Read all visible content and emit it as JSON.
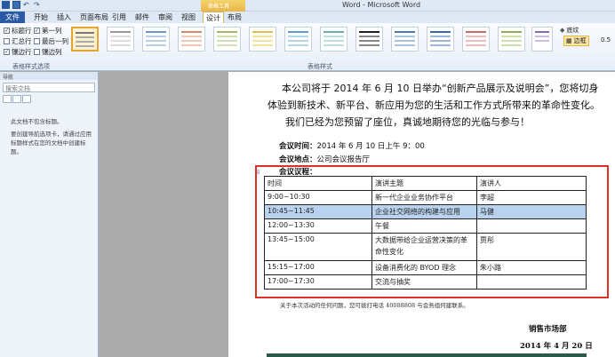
{
  "window": {
    "title": "Word - Microsoft Word",
    "context_tab": "表格工具"
  },
  "tabs": [
    "文件",
    "开始",
    "插入",
    "页面布局",
    "引用",
    "邮件",
    "审阅",
    "视图",
    "设计",
    "布局"
  ],
  "table_options": {
    "group_label": "表格样式选项",
    "items": [
      {
        "label": "标题行",
        "checked": true
      },
      {
        "label": "第一列",
        "checked": true
      },
      {
        "label": "汇总行",
        "checked": false
      },
      {
        "label": "最后一列",
        "checked": false
      },
      {
        "label": "镶边行",
        "checked": true
      },
      {
        "label": "镶边列",
        "checked": false
      }
    ]
  },
  "styles_group_label": "表格样式",
  "right_panel": {
    "shading": "底纹",
    "borders": "边框",
    "pen_weight": "0.5"
  },
  "nav_pane": {
    "title": "导航",
    "search_placeholder": "搜索文档",
    "msg1": "此文档不包含标题。",
    "msg2": "要创建导航选项卡，请通过应用标题样式在您的文档中创建标题。"
  },
  "document": {
    "intro_lines": [
      "本公司将于 2014 年 6 月 10 日举办“创新产品展示及说明会”，您将切身",
      "体验到新技术、新平台、新应用为您的生活和工作方式所带来的革命性变化。",
      "我们已经为您预留了座位，真诚地期待您的光临与参与！"
    ],
    "meeting_time_label": "会议时间：",
    "meeting_time_value": "2014 年 6 月 10 日上午 9：00",
    "meeting_place_label": "会议地点：",
    "meeting_place_value": "公司会议报告厅",
    "agenda_label": "会议议程：",
    "table_header": [
      "时间",
      "演讲主题",
      "演讲人"
    ],
    "table_rows": [
      [
        "9:00~10:30",
        "新一代企业业务协作平台",
        "李超"
      ],
      [
        "10:45~11:45",
        "企业社交网络的构建与应用",
        "马健"
      ],
      [
        "12:00~13:30",
        "午餐",
        ""
      ],
      [
        "13:45~15:00",
        "大数据带给企业运营决策的革命性变化",
        "贾彤"
      ],
      [
        "15:15~17:00",
        "设备消费化的 BYOD 理念",
        "朱小路"
      ],
      [
        "17:00~17:30",
        "交流与抽奖",
        ""
      ]
    ],
    "footer_note": "关于本次活动的任何问题，您可拨打电话 40088808 与会务组何建联系。",
    "signature_dept": "销售市场部",
    "signature_date": "2014 年 4 月 20 日"
  }
}
